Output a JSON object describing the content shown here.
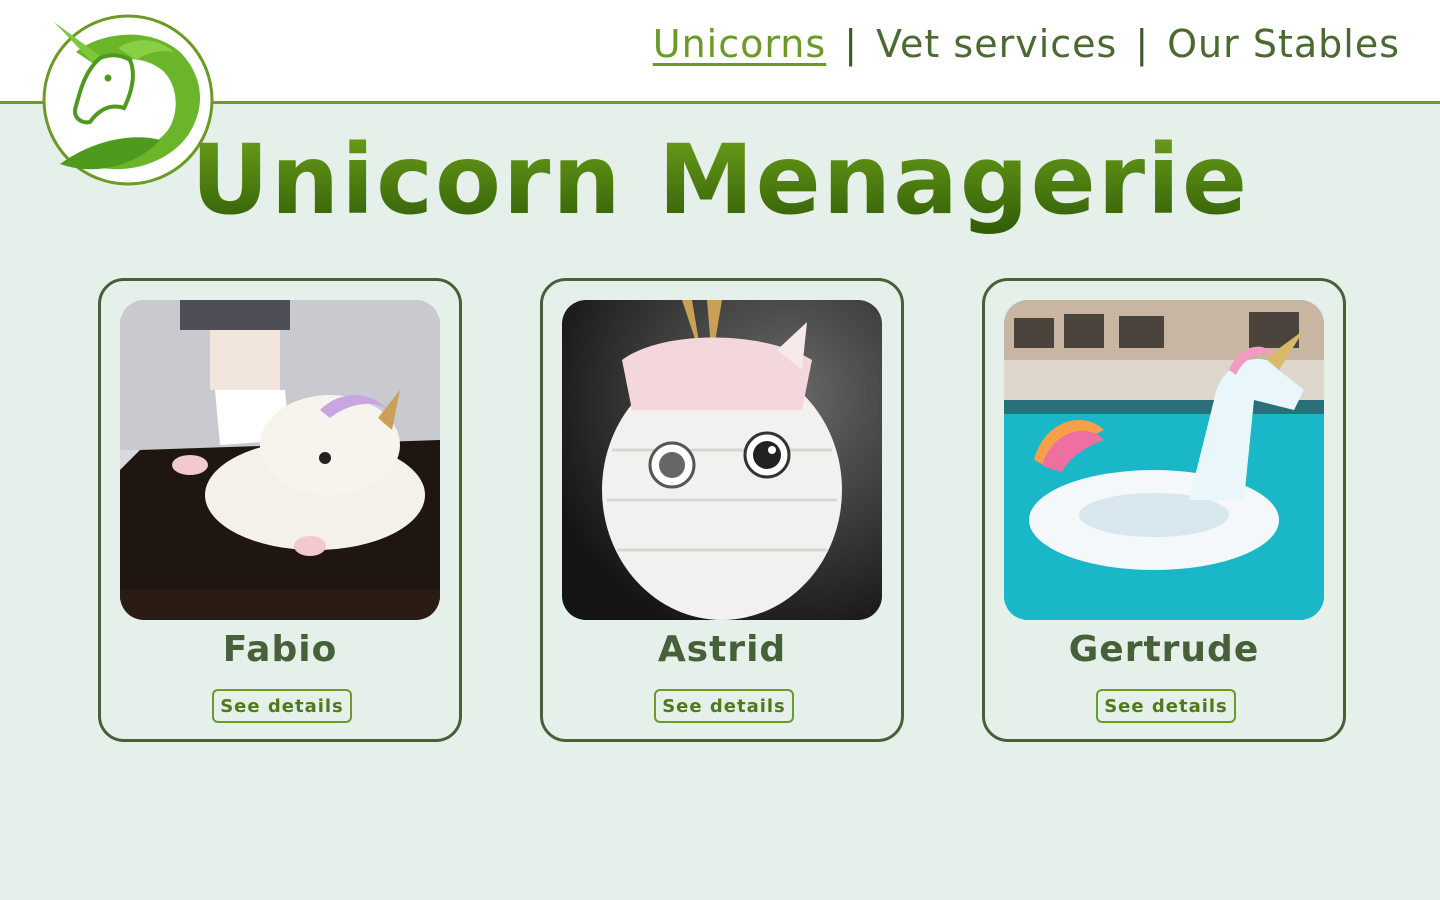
{
  "brand": {
    "logo_icon": "unicorn-head-logo-icon"
  },
  "nav": {
    "items": [
      {
        "label": "Unicorns",
        "active": true
      },
      {
        "label": "Vet services",
        "active": false
      },
      {
        "label": "Our Stables",
        "active": false
      }
    ],
    "separator": "|"
  },
  "page": {
    "title": "Unicorn Menagerie"
  },
  "cards": [
    {
      "name": "Fabio",
      "button": "See details",
      "image": "unicorn-slipper-photo"
    },
    {
      "name": "Astrid",
      "button": "See details",
      "image": "unicorn-pinata-photo"
    },
    {
      "name": "Gertrude",
      "button": "See details",
      "image": "unicorn-pool-float-photo"
    }
  ],
  "colors": {
    "accent": "#6b9a26",
    "dark_green": "#46603a",
    "background": "#e6f0ea",
    "title_gradient_top": "#6fa31a",
    "title_gradient_bottom": "#2f5a07"
  }
}
